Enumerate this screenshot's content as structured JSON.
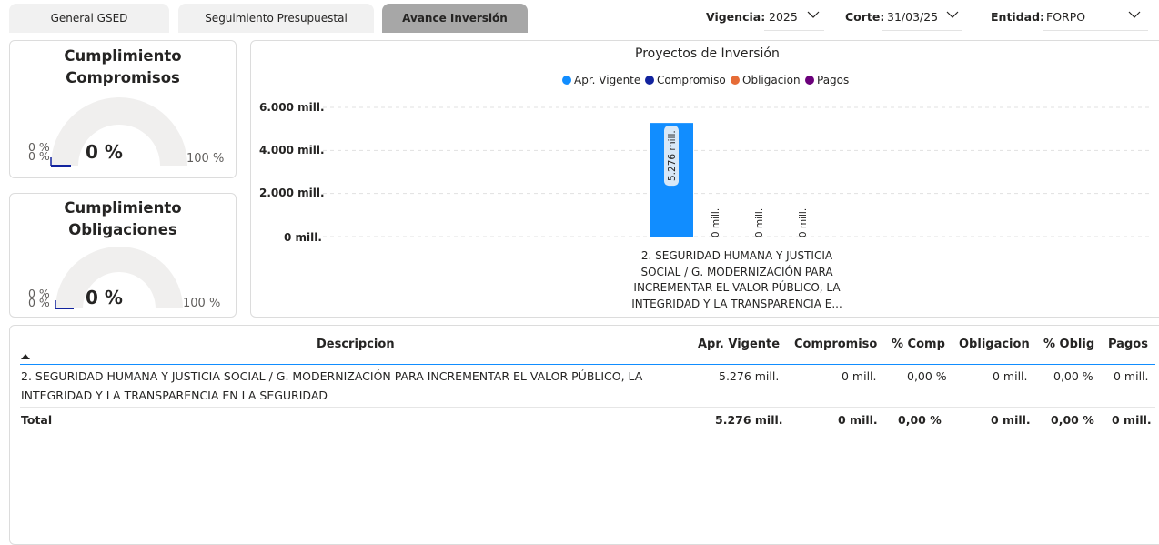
{
  "tabs": [
    {
      "label": "General GSED",
      "active": false
    },
    {
      "label": "Seguimiento Presupuestal",
      "active": false
    },
    {
      "label": "Avance Inversión",
      "active": true
    }
  ],
  "filters": {
    "vigencia_label": "Vigencia:",
    "vigencia_value": "2025",
    "corte_label": "Corte:",
    "corte_value": "31/03/25",
    "entidad_label": "Entidad:",
    "entidad_value": "FORPO"
  },
  "gauges": [
    {
      "title_line1": "Cumplimiento",
      "title_line2": "Compromisos",
      "value_label": "0 %",
      "value": 0,
      "min_label": "0 %",
      "max_label": "100 %",
      "tiny_top": "0 %",
      "tiny_bottom": "0 %"
    },
    {
      "title_line1": "Cumplimiento",
      "title_line2": "Obligaciones",
      "value_label": "0 %",
      "value": 0,
      "min_label": "0 %",
      "max_label": "100 %",
      "tiny_top": "0 %",
      "tiny_bottom": "0 %"
    }
  ],
  "chart_data": {
    "type": "bar",
    "title": "Proyectos de Inversión",
    "categories": [
      "2. SEGURIDAD HUMANA Y JUSTICIA SOCIAL / G. MODERNIZACIÓN PARA INCREMENTAR EL VALOR PÚBLICO, LA INTEGRIDAD Y LA TRANSPARENCIA E..."
    ],
    "category_lines": [
      "2. SEGURIDAD HUMANA Y JUSTICIA",
      "SOCIAL / G. MODERNIZACIÓN PARA",
      "INCREMENTAR EL VALOR PÚBLICO, LA",
      "INTEGRIDAD Y LA TRANSPARENCIA E..."
    ],
    "series": [
      {
        "name": "Apr. Vigente",
        "values": [
          5276
        ],
        "label": "5.276 mill.",
        "color": "#118dff"
      },
      {
        "name": "Compromiso",
        "values": [
          0
        ],
        "label": "0 mill.",
        "color": "#12239e"
      },
      {
        "name": "Obligacion",
        "values": [
          0
        ],
        "label": "0 mill.",
        "color": "#e66c37"
      },
      {
        "name": "Pagos",
        "values": [
          0
        ],
        "label": "0 mill.",
        "color": "#6b007b"
      }
    ],
    "ylim": [
      0,
      6000
    ],
    "yticks": [
      0,
      2000,
      4000,
      6000
    ],
    "ytick_labels": [
      "0 mill.",
      "2.000 mill.",
      "4.000 mill.",
      "6.000 mill."
    ],
    "grid": true,
    "legend_position": "top-center"
  },
  "table": {
    "headers": [
      "Descripcion",
      "Apr. Vigente",
      "Compromiso",
      "% Comp",
      "Obligacion",
      "% Oblig",
      "Pagos"
    ],
    "rows": [
      {
        "desc_line1": "2. SEGURIDAD HUMANA Y JUSTICIA SOCIAL / G. MODERNIZACIÓN PARA INCREMENTAR EL VALOR PÚBLICO, LA",
        "desc_line2": "INTEGRIDAD Y LA TRANSPARENCIA EN LA SEGURIDAD",
        "apr": "5.276 mill.",
        "comp": "0 mill.",
        "pcomp": "0,00 %",
        "oblig": "0 mill.",
        "poblig": "0,00 %",
        "pagos": "0 mill."
      }
    ],
    "total": {
      "label": "Total",
      "apr": "5.276 mill.",
      "comp": "0 mill.",
      "pcomp": "0,00 %",
      "oblig": "0 mill.",
      "poblig": "0,00 %",
      "pagos": "0 mill."
    }
  }
}
